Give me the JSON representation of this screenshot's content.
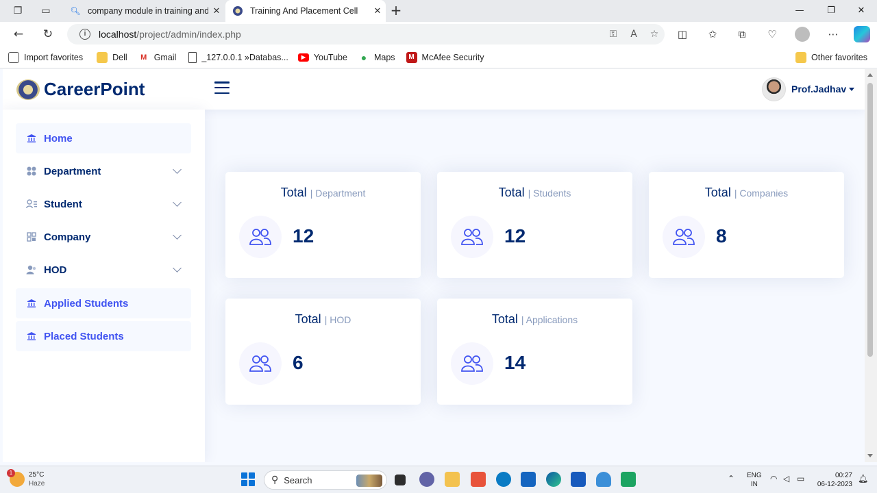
{
  "browser": {
    "tabs": [
      {
        "title": "company module in training and"
      },
      {
        "title": "Training And Placement Cell"
      }
    ],
    "url_host": "localhost",
    "url_path": "/project/admin/index.php",
    "favorites": [
      {
        "label": "Import favorites",
        "icon": "import-icon"
      },
      {
        "label": "Dell",
        "icon": "folder-icon"
      },
      {
        "label": "Gmail",
        "icon": "gmail-icon"
      },
      {
        "label": "_127.0.0.1 »Databas...",
        "icon": "page-icon"
      },
      {
        "label": "YouTube",
        "icon": "youtube-icon"
      },
      {
        "label": "Maps",
        "icon": "maps-icon"
      },
      {
        "label": "McAfee Security",
        "icon": "mcafee-icon"
      }
    ],
    "other_favorites": "Other favorites"
  },
  "header": {
    "logo_text": "CareerPoint",
    "user_name": "Prof.Jadhav"
  },
  "sidebar": {
    "items": [
      {
        "label": "Home",
        "icon": "bank-icon",
        "style": "filled",
        "expandable": false
      },
      {
        "label": "Department",
        "icon": "grid-icon",
        "style": "plain",
        "expandable": true
      },
      {
        "label": "Student",
        "icon": "person-lines-icon",
        "style": "plain",
        "expandable": true
      },
      {
        "label": "Company",
        "icon": "building-icon",
        "style": "plain",
        "expandable": true
      },
      {
        "label": "HOD",
        "icon": "person-icon",
        "style": "plain",
        "expandable": true
      },
      {
        "label": "Applied Students",
        "icon": "bank-icon",
        "style": "filled",
        "expandable": false
      },
      {
        "label": "Placed Students",
        "icon": "bank-icon",
        "style": "filled",
        "expandable": false
      }
    ]
  },
  "cards": [
    {
      "title": "Total",
      "subtitle": "| Department",
      "value": "12",
      "icon": "people-icon"
    },
    {
      "title": "Total",
      "subtitle": "| Students",
      "value": "12",
      "icon": "people-icon"
    },
    {
      "title": "Total",
      "subtitle": "| Companies",
      "value": "8",
      "icon": "people-icon"
    },
    {
      "title": "Total",
      "subtitle": "| HOD",
      "value": "6",
      "icon": "people-icon"
    },
    {
      "title": "Total",
      "subtitle": "| Applications",
      "value": "14",
      "icon": "people-icon"
    }
  ],
  "taskbar": {
    "weather_temp": "25°C",
    "weather_desc": "Haze",
    "weather_badge": "1",
    "search_label": "Search",
    "lang_1": "ENG",
    "lang_2": "IN",
    "time": "00:27",
    "date": "06-12-2023"
  },
  "colors": {
    "primary_text": "#012970",
    "accent": "#4154f1",
    "muted": "#899bbd",
    "background": "#f6f9ff"
  }
}
